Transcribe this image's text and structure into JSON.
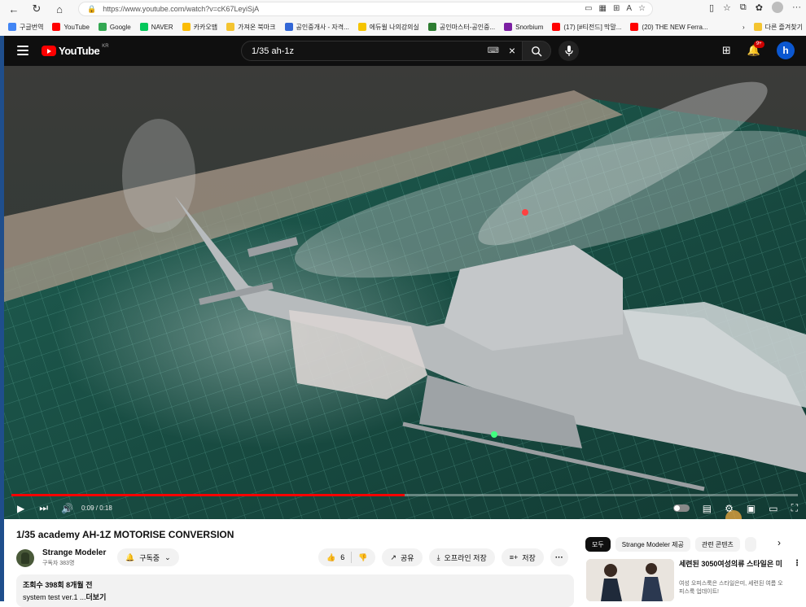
{
  "browser": {
    "url": "https://www.youtube.com/watch?v=cK67LeyiSjA",
    "bookmarks": [
      {
        "label": "구글번역",
        "color": "#4285f4"
      },
      {
        "label": "YouTube",
        "color": "#ff0000"
      },
      {
        "label": "Google",
        "color": "#34a853"
      },
      {
        "label": "NAVER",
        "color": "#03c75a"
      },
      {
        "label": "카카오맵",
        "color": "#fbbc04"
      },
      {
        "label": "가져온 북마크",
        "color": "#f4c430"
      },
      {
        "label": "공인중개사 - 자격...",
        "color": "#3367d6"
      },
      {
        "label": "에듀윌 나의강의실",
        "color": "#f5c400"
      },
      {
        "label": "공인마스터-공인중...",
        "color": "#2e7d32"
      },
      {
        "label": "Snorbium",
        "color": "#7b1fa2"
      },
      {
        "label": "(17) [#티전드] 막말...",
        "color": "#ff0000"
      },
      {
        "label": "(20) THE NEW Ferra...",
        "color": "#ff0000"
      }
    ],
    "bookmarks_folder": "다른 즐겨찾기"
  },
  "youtube": {
    "logo_text": "YouTube",
    "logo_region": "KR",
    "search_query": "1/35 ah-1z",
    "notification_count": "9+",
    "avatar_letter": "h"
  },
  "player": {
    "time_display": "0:09 / 0:18",
    "progress_fraction": 0.5,
    "colors": {
      "progress": "#ff0000"
    }
  },
  "video": {
    "title": "1/35 academy AH-1Z MOTORISE CONVERSION",
    "channel_name": "Strange Modeler",
    "subscribers": "구독자 383명",
    "subscribe_label": "구독중",
    "likes": "6",
    "share_label": "공유",
    "download_label": "오프라인 저장",
    "save_label": "저장",
    "meta": "조회수 398회  8개월 전",
    "description": "system test ver.1 ...",
    "more_label": "더보기"
  },
  "sidebar": {
    "chips": [
      "모두",
      "Strange Modeler 제공",
      "관련 콘텐츠"
    ],
    "rec": {
      "title": "세련된 3050여성의류 스타일은 미",
      "desc": "여성 오피스룩은 스타일은미, 세련된 여름 오피스룩 업데이트!"
    }
  }
}
